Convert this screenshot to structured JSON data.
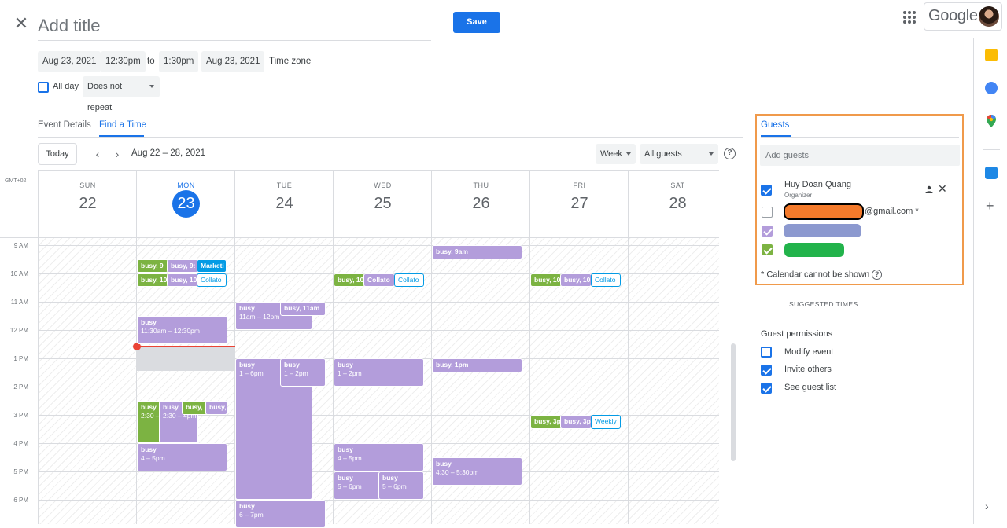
{
  "header": {
    "title_placeholder": "Add title",
    "save_label": "Save",
    "google_label": "Google"
  },
  "datetime": {
    "start_date": "Aug 23, 2021",
    "start_time": "12:30pm",
    "to_label": "to",
    "end_time": "1:30pm",
    "end_date": "Aug 23, 2021",
    "timezone_label": "Time zone",
    "all_day_label": "All day",
    "repeat_label": "Does not repeat"
  },
  "tabs": {
    "event_details": "Event Details",
    "find_a_time": "Find a Time"
  },
  "toolbar": {
    "today_label": "Today",
    "range_label": "Aug 22 – 28, 2021",
    "view_label": "Week",
    "guests_filter_label": "All guests"
  },
  "calendar": {
    "timezone": "GMT+02",
    "days": [
      {
        "name": "SUN",
        "num": "22"
      },
      {
        "name": "MON",
        "num": "23"
      },
      {
        "name": "TUE",
        "num": "24"
      },
      {
        "name": "WED",
        "num": "25"
      },
      {
        "name": "THU",
        "num": "26"
      },
      {
        "name": "FRI",
        "num": "27"
      },
      {
        "name": "SAT",
        "num": "28"
      }
    ],
    "hours": [
      "9 AM",
      "10 AM",
      "11 AM",
      "12 PM",
      "1 PM",
      "2 PM",
      "3 PM",
      "4 PM",
      "5 PM",
      "6 PM"
    ],
    "events": {
      "mon_9_a": "busy, 9",
      "mon_9_b": "busy, 9:",
      "mon_9_c": "Marketi",
      "mon_10_a": "busy, 10",
      "mon_10_b": "busy, 10",
      "mon_10_c": "Collato",
      "mon_1130_t": "busy",
      "mon_1130_s": "11:30am – 12:30pm",
      "mon_230_a_t": "busy",
      "mon_230_a_s": "2:30 –",
      "mon_230_b_t": "busy",
      "mon_230_b_s": "2:30 – 4pm",
      "mon_230_c": "busy,",
      "mon_230_d": "busy,",
      "mon_4_t": "busy",
      "mon_4_s": "4 – 5pm",
      "tue_11_a_t": "busy",
      "tue_11_a_s": "11am – 12pm",
      "tue_11_b": "busy, 11am",
      "tue_1_a_t": "busy",
      "tue_1_a_s": "1 – 6pm",
      "tue_1_b_t": "busy",
      "tue_1_b_s": "1 – 2pm",
      "tue_6_t": "busy",
      "tue_6_s": "6 – 7pm",
      "wed_10_a": "busy, 10",
      "wed_10_b": "Collato",
      "wed_10_c": "Collato",
      "wed_1_t": "busy",
      "wed_1_s": "1 – 2pm",
      "wed_4_t": "busy",
      "wed_4_s": "4 – 5pm",
      "wed_5_a_t": "busy",
      "wed_5_a_s": "5 – 6pm",
      "wed_5_b_t": "busy",
      "wed_5_b_s": "5 – 6pm",
      "thu_9": "busy, 9am",
      "thu_1": "busy, 1pm",
      "thu_430_t": "busy",
      "thu_430_s": "4:30 – 5:30pm",
      "fri_10_a": "busy, 10",
      "fri_10_b": "busy, 10",
      "fri_10_c": "Collato",
      "fri_3_a": "busy, 3p",
      "fri_3_b": "busy, 3p",
      "fri_3_c": "Weekly"
    }
  },
  "guests": {
    "tab_label": "Guests",
    "add_placeholder": "Add guests",
    "organizer_name": "Huy Doan Quang",
    "organizer_role": "Organizer",
    "guest2_suffix": "@gmail.com *",
    "note": "* Calendar cannot be shown",
    "suggested_times": "SUGGESTED TIMES"
  },
  "permissions": {
    "title": "Guest permissions",
    "modify": "Modify event",
    "invite": "Invite others",
    "see_list": "See guest list"
  },
  "colors": {
    "accent": "#1a73e8",
    "event_purple": "#b39ddb",
    "event_green": "#7cb342",
    "highlight_frame": "#f09a4b"
  }
}
